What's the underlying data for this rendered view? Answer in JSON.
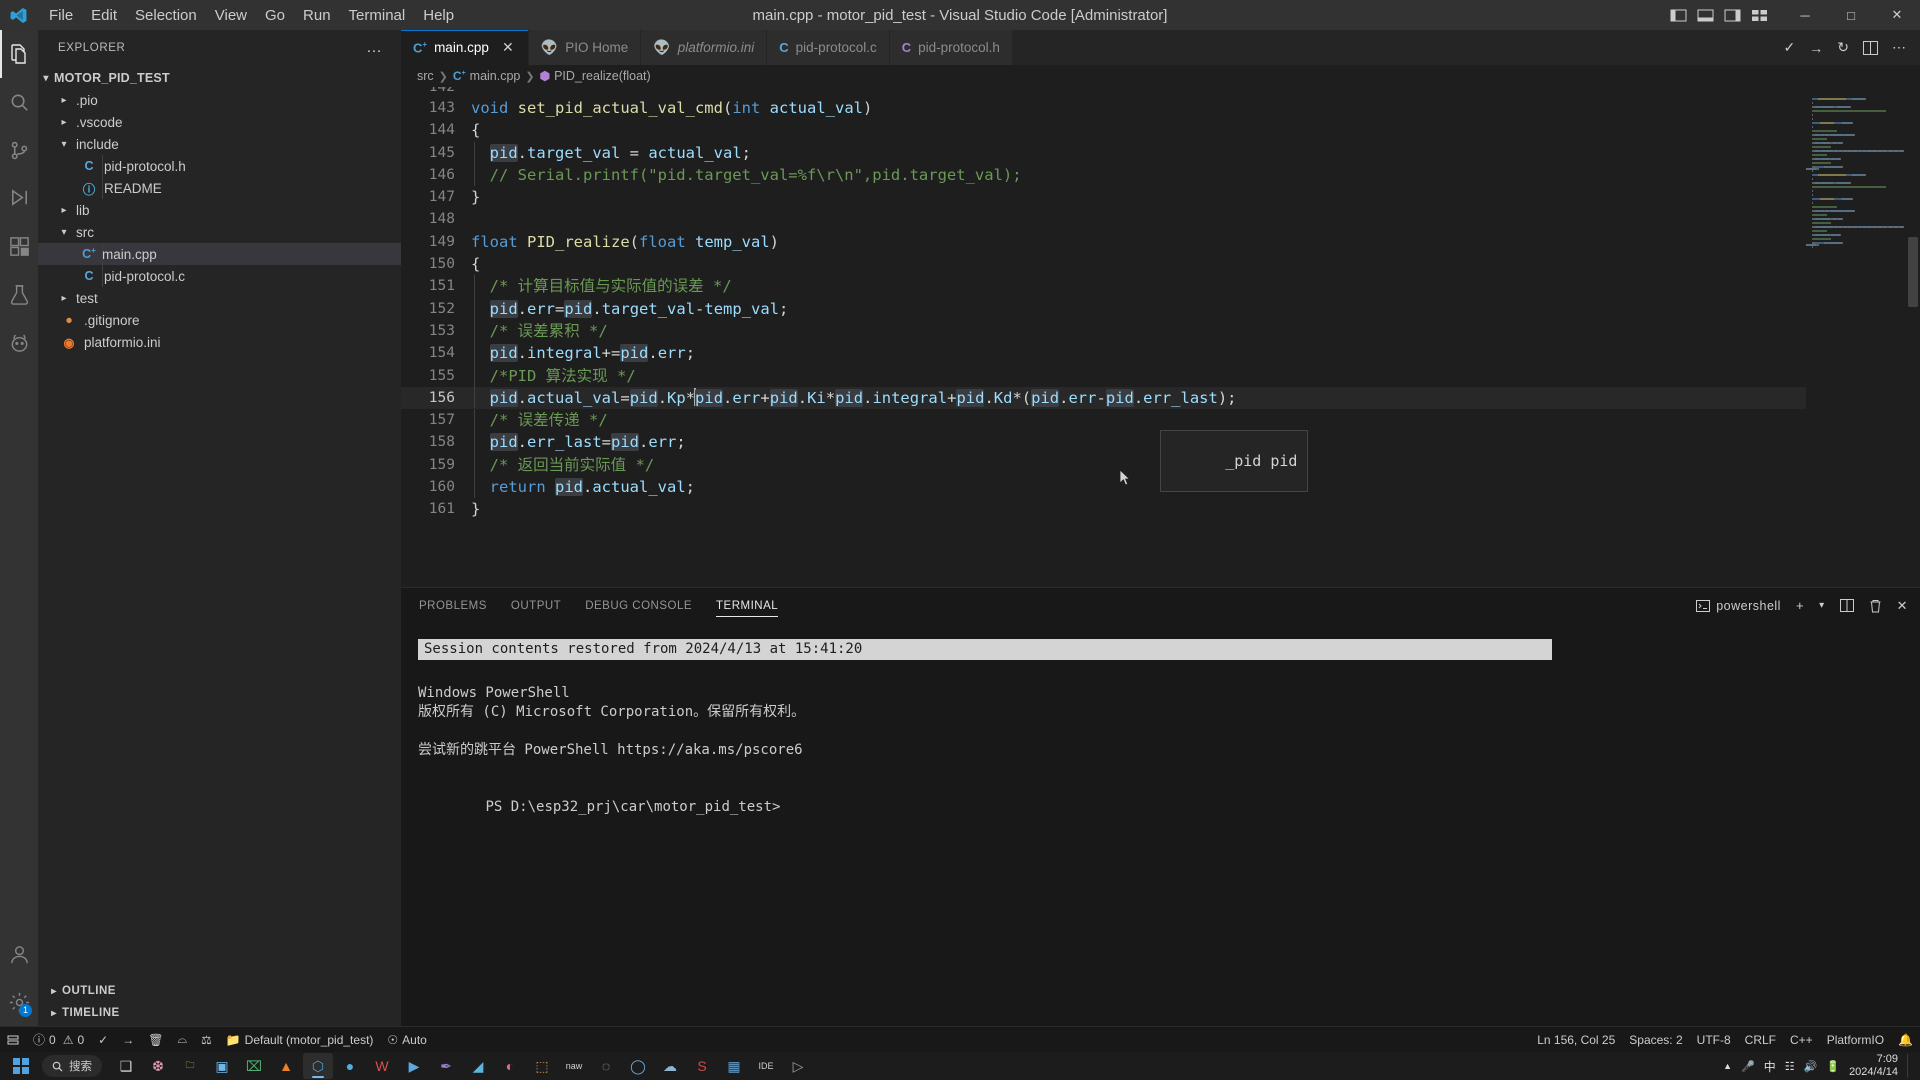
{
  "window": {
    "title": "main.cpp - motor_pid_test - Visual Studio Code [Administrator]",
    "menus": [
      "File",
      "Edit",
      "Selection",
      "View",
      "Go",
      "Run",
      "Terminal",
      "Help"
    ],
    "controls": {
      "minimize": "─",
      "maximize": "□",
      "close": "✕"
    }
  },
  "activitybar": {
    "items": [
      {
        "name": "explorer",
        "icon": "files-icon"
      },
      {
        "name": "search",
        "icon": "search-icon"
      },
      {
        "name": "source-control",
        "icon": "source-control-icon"
      },
      {
        "name": "run-debug",
        "icon": "run-debug-icon"
      },
      {
        "name": "extensions",
        "icon": "extensions-icon"
      },
      {
        "name": "testing",
        "icon": "beaker-icon"
      },
      {
        "name": "platformio",
        "icon": "alien-icon"
      }
    ],
    "bottom": [
      {
        "name": "accounts",
        "icon": "account-icon"
      },
      {
        "name": "settings",
        "icon": "gear-icon",
        "badge": "1"
      }
    ]
  },
  "sidebar": {
    "header": "EXPLORER",
    "more_label": "…",
    "root": "MOTOR_PID_TEST",
    "items": [
      {
        "label": ".pio",
        "type": "folder",
        "expanded": false,
        "depth": 1
      },
      {
        "label": ".vscode",
        "type": "folder",
        "expanded": false,
        "depth": 1
      },
      {
        "label": "include",
        "type": "folder",
        "expanded": true,
        "depth": 1
      },
      {
        "label": "pid-protocol.h",
        "type": "file-c",
        "depth": 2
      },
      {
        "label": "README",
        "type": "file-info",
        "depth": 2
      },
      {
        "label": "lib",
        "type": "folder",
        "expanded": false,
        "depth": 1
      },
      {
        "label": "src",
        "type": "folder",
        "expanded": true,
        "depth": 1
      },
      {
        "label": "main.cpp",
        "type": "file-cpp",
        "depth": 2,
        "selected": true
      },
      {
        "label": "pid-protocol.c",
        "type": "file-c",
        "depth": 2
      },
      {
        "label": "test",
        "type": "folder",
        "expanded": false,
        "depth": 1
      },
      {
        "label": ".gitignore",
        "type": "file-git",
        "depth": 1
      },
      {
        "label": "platformio.ini",
        "type": "file-ini",
        "depth": 1
      }
    ],
    "sections": [
      "OUTLINE",
      "TIMELINE"
    ]
  },
  "tabs": [
    {
      "label": "main.cpp",
      "icon": "cpp-file-icon",
      "active": true,
      "italic": false,
      "closable": true
    },
    {
      "label": "PIO Home",
      "icon": "platformio-icon",
      "active": false,
      "italic": false,
      "closable": false
    },
    {
      "label": "platformio.ini",
      "icon": "platformio-icon",
      "active": false,
      "italic": true,
      "closable": false
    },
    {
      "label": "pid-protocol.c",
      "icon": "c-file-icon",
      "active": false,
      "italic": false,
      "closable": false
    },
    {
      "label": "pid-protocol.h",
      "icon": "h-file-icon",
      "active": false,
      "italic": false,
      "closable": false
    }
  ],
  "editor_actions": [
    "check-icon",
    "split-icon",
    "refresh-icon",
    "layout-icon",
    "more-icon"
  ],
  "breadcrumb": [
    {
      "label": "src",
      "icon": ""
    },
    {
      "label": "main.cpp",
      "icon": "cpp-file-icon"
    },
    {
      "label": "PID_realize(float)",
      "icon": "function-icon"
    }
  ],
  "code": {
    "first_partial_line": "142",
    "cursor_line": 156,
    "lines": [
      {
        "n": "143",
        "tokens": [
          {
            "t": "void ",
            "c": "kw"
          },
          {
            "t": "set_pid_actual_val_cmd",
            "c": "fn"
          },
          {
            "t": "(",
            "c": "op"
          },
          {
            "t": "int",
            "c": "kw"
          },
          {
            "t": " ",
            "c": "op"
          },
          {
            "t": "actual_val",
            "c": "var"
          },
          {
            "t": ")",
            "c": "op"
          }
        ]
      },
      {
        "n": "144",
        "tokens": [
          {
            "t": "{",
            "c": "op"
          }
        ]
      },
      {
        "n": "145",
        "tokens": [
          {
            "t": "  ",
            "c": "op"
          },
          {
            "t": "pid",
            "c": "var hl"
          },
          {
            "t": ".",
            "c": "op"
          },
          {
            "t": "target_val",
            "c": "var"
          },
          {
            "t": " = ",
            "c": "op"
          },
          {
            "t": "actual_val",
            "c": "var"
          },
          {
            "t": ";",
            "c": "op"
          }
        ]
      },
      {
        "n": "146",
        "tokens": [
          {
            "t": "  // Serial.printf(\"pid.target_val=%f\\r\\n\",pid.target_val);",
            "c": "cmt"
          }
        ]
      },
      {
        "n": "147",
        "tokens": [
          {
            "t": "}",
            "c": "op"
          }
        ]
      },
      {
        "n": "148",
        "tokens": [
          {
            "t": "",
            "c": "op"
          }
        ]
      },
      {
        "n": "149",
        "tokens": [
          {
            "t": "float ",
            "c": "kw"
          },
          {
            "t": "PID_realize",
            "c": "fn"
          },
          {
            "t": "(",
            "c": "op"
          },
          {
            "t": "float",
            "c": "kw"
          },
          {
            "t": " ",
            "c": "op"
          },
          {
            "t": "temp_val",
            "c": "var"
          },
          {
            "t": ")",
            "c": "op"
          }
        ]
      },
      {
        "n": "150",
        "tokens": [
          {
            "t": "{",
            "c": "op"
          }
        ]
      },
      {
        "n": "151",
        "tokens": [
          {
            "t": "  /* 计算目标值与实际值的误差 */",
            "c": "cmt"
          }
        ]
      },
      {
        "n": "152",
        "tokens": [
          {
            "t": "  ",
            "c": "op"
          },
          {
            "t": "pid",
            "c": "var hl"
          },
          {
            "t": ".",
            "c": "op"
          },
          {
            "t": "err",
            "c": "var"
          },
          {
            "t": "=",
            "c": "op"
          },
          {
            "t": "pid",
            "c": "var hl"
          },
          {
            "t": ".",
            "c": "op"
          },
          {
            "t": "target_val",
            "c": "var"
          },
          {
            "t": "-",
            "c": "op"
          },
          {
            "t": "temp_val",
            "c": "var"
          },
          {
            "t": ";",
            "c": "op"
          }
        ]
      },
      {
        "n": "153",
        "tokens": [
          {
            "t": "  /* 误差累积 */",
            "c": "cmt"
          }
        ]
      },
      {
        "n": "154",
        "tokens": [
          {
            "t": "  ",
            "c": "op"
          },
          {
            "t": "pid",
            "c": "var hl"
          },
          {
            "t": ".",
            "c": "op"
          },
          {
            "t": "integral",
            "c": "var"
          },
          {
            "t": "+=",
            "c": "op"
          },
          {
            "t": "pid",
            "c": "var hl"
          },
          {
            "t": ".",
            "c": "op"
          },
          {
            "t": "err",
            "c": "var"
          },
          {
            "t": ";",
            "c": "op"
          }
        ]
      },
      {
        "n": "155",
        "tokens": [
          {
            "t": "  /*PID 算法实现 */",
            "c": "cmt"
          }
        ]
      },
      {
        "n": "156",
        "current": true,
        "tokens": [
          {
            "t": "  ",
            "c": "op"
          },
          {
            "t": "pid",
            "c": "var hl"
          },
          {
            "t": ".",
            "c": "op"
          },
          {
            "t": "actual_val",
            "c": "var"
          },
          {
            "t": "=",
            "c": "op"
          },
          {
            "t": "pid",
            "c": "var hl"
          },
          {
            "t": ".",
            "c": "op"
          },
          {
            "t": "Kp",
            "c": "var"
          },
          {
            "t": "*",
            "c": "op"
          },
          {
            "t": "CARET",
            "c": "caret"
          },
          {
            "t": "pid",
            "c": "var hl"
          },
          {
            "t": ".",
            "c": "op"
          },
          {
            "t": "err",
            "c": "var"
          },
          {
            "t": "+",
            "c": "op"
          },
          {
            "t": "pid",
            "c": "var hl"
          },
          {
            "t": ".",
            "c": "op"
          },
          {
            "t": "Ki",
            "c": "var"
          },
          {
            "t": "*",
            "c": "op"
          },
          {
            "t": "pid",
            "c": "var hl"
          },
          {
            "t": ".",
            "c": "op"
          },
          {
            "t": "integral",
            "c": "var"
          },
          {
            "t": "+",
            "c": "op"
          },
          {
            "t": "pid",
            "c": "var hl"
          },
          {
            "t": ".",
            "c": "op"
          },
          {
            "t": "Kd",
            "c": "var"
          },
          {
            "t": "*(",
            "c": "op"
          },
          {
            "t": "pid",
            "c": "var hl"
          },
          {
            "t": ".",
            "c": "op"
          },
          {
            "t": "err",
            "c": "var"
          },
          {
            "t": "-",
            "c": "op"
          },
          {
            "t": "pid",
            "c": "var hl"
          },
          {
            "t": ".",
            "c": "op"
          },
          {
            "t": "err_last",
            "c": "var"
          },
          {
            "t": ");",
            "c": "op"
          }
        ]
      },
      {
        "n": "157",
        "tokens": [
          {
            "t": "  /* 误差传递 */",
            "c": "cmt"
          }
        ]
      },
      {
        "n": "158",
        "tokens": [
          {
            "t": "  ",
            "c": "op"
          },
          {
            "t": "pid",
            "c": "var hl"
          },
          {
            "t": ".",
            "c": "op"
          },
          {
            "t": "err_last",
            "c": "var"
          },
          {
            "t": "=",
            "c": "op"
          },
          {
            "t": "pid",
            "c": "var hl"
          },
          {
            "t": ".",
            "c": "op"
          },
          {
            "t": "err",
            "c": "var"
          },
          {
            "t": ";",
            "c": "op"
          }
        ]
      },
      {
        "n": "159",
        "tokens": [
          {
            "t": "  /* 返回当前实际值 */",
            "c": "cmt"
          }
        ]
      },
      {
        "n": "160",
        "tokens": [
          {
            "t": "  ",
            "c": "op"
          },
          {
            "t": "return ",
            "c": "kw"
          },
          {
            "t": "pid",
            "c": "var hl"
          },
          {
            "t": ".",
            "c": "op"
          },
          {
            "t": "actual_val",
            "c": "var"
          },
          {
            "t": ";",
            "c": "op"
          }
        ]
      },
      {
        "n": "161",
        "tokens": [
          {
            "t": "}",
            "c": "op"
          }
        ]
      }
    ]
  },
  "tooltip": {
    "text": "_pid pid"
  },
  "panel": {
    "tabs": [
      {
        "label": "PROBLEMS",
        "active": false
      },
      {
        "label": "OUTPUT",
        "active": false
      },
      {
        "label": "DEBUG CONSOLE",
        "active": false
      },
      {
        "label": "TERMINAL",
        "active": true
      }
    ],
    "shell": "powershell",
    "actions": [
      "add-terminal-icon",
      "chevron-down-icon",
      "split-terminal-icon",
      "kill-terminal-icon",
      "close-panel-icon"
    ],
    "terminal": {
      "restored_notice": "Session contents restored from 2024/4/13 at 15:41:20",
      "lines": [
        "Windows PowerShell",
        "版权所有 (C) Microsoft Corporation。保留所有权利。",
        "",
        "尝试新的跳平台 PowerShell https://aka.ms/pscore6",
        "",
        "PS D:\\esp32_prj\\car\\motor_pid_test>"
      ]
    }
  },
  "statusbar": {
    "left": [
      {
        "name": "remote-indicator",
        "label": ""
      },
      {
        "name": "problems",
        "label": "0  0",
        "icon": "error-warning-icon"
      },
      {
        "name": "pio-build",
        "label": "",
        "icon": "check-icon"
      },
      {
        "name": "pio-upload",
        "label": "",
        "icon": "arrow-right-icon"
      },
      {
        "name": "pio-clean",
        "label": "",
        "icon": "trash-icon"
      },
      {
        "name": "pio-test",
        "label": "",
        "icon": "beaker-icon"
      },
      {
        "name": "pio-serial",
        "label": "",
        "icon": "plug-icon"
      },
      {
        "name": "pio-env",
        "label": "Default (motor_pid_test)",
        "icon": "folder-icon"
      },
      {
        "name": "pio-auto",
        "label": "Auto",
        "icon": "target-icon"
      }
    ],
    "right": [
      {
        "name": "cursor-position",
        "label": "Ln 156, Col 25"
      },
      {
        "name": "indentation",
        "label": "Spaces: 2"
      },
      {
        "name": "encoding",
        "label": "UTF-8"
      },
      {
        "name": "eol",
        "label": "CRLF"
      },
      {
        "name": "language-mode",
        "label": "C++"
      },
      {
        "name": "platformio",
        "label": "PlatformIO"
      },
      {
        "name": "notifications",
        "label": "",
        "icon": "bell-icon"
      }
    ]
  },
  "taskbar": {
    "search_placeholder": "搜索",
    "clock": {
      "time": "7:09",
      "date": "2024/4/14"
    },
    "ime": "中",
    "apps": [
      {
        "name": "taskview",
        "glyph": "❑",
        "color": "#cfcfcf"
      },
      {
        "name": "widgets",
        "glyph": "❆",
        "color": "#f0a3c0"
      },
      {
        "name": "explorer",
        "glyph": "🗀",
        "color": "#e8c35b"
      },
      {
        "name": "store",
        "glyph": "▣",
        "color": "#6fb7e8"
      },
      {
        "name": "excel",
        "glyph": "⌧",
        "color": "#4fae6e"
      },
      {
        "name": "vlc",
        "glyph": "▲",
        "color": "#e8822b"
      },
      {
        "name": "vscode",
        "glyph": "⬡",
        "color": "#4f9fd4",
        "active": true
      },
      {
        "name": "edge",
        "glyph": "●",
        "color": "#4cb0e0"
      },
      {
        "name": "wps",
        "glyph": "W",
        "color": "#d9504a"
      },
      {
        "name": "player",
        "glyph": "▶",
        "color": "#5ca8e0"
      },
      {
        "name": "paint",
        "glyph": "✒",
        "color": "#9a7fd4"
      },
      {
        "name": "drawing",
        "glyph": "◢",
        "color": "#5bb3e0"
      },
      {
        "name": "palette",
        "glyph": "◐",
        "color": "#e06c8a"
      },
      {
        "name": "charts",
        "glyph": "⬚",
        "color": "#c3974f"
      },
      {
        "name": "naw",
        "glyph": "naw",
        "color": "#d4d4d4"
      },
      {
        "name": "chat",
        "glyph": "◌",
        "color": "#b0b0b0"
      },
      {
        "name": "disc",
        "glyph": "◯",
        "color": "#6ea8d8"
      },
      {
        "name": "cloud",
        "glyph": "☁",
        "color": "#8fb4cf"
      },
      {
        "name": "sw2018",
        "glyph": "S",
        "color": "#d04a4a"
      },
      {
        "name": "pictures",
        "glyph": "▦",
        "color": "#5f9ecf"
      },
      {
        "name": "ide",
        "glyph": "IDE",
        "color": "#cfcfcf"
      },
      {
        "name": "terminal-app",
        "glyph": "▷",
        "color": "#a0a0a0"
      }
    ],
    "tray": [
      "chevron-up-icon",
      "mic-icon",
      "network-icon",
      "volume-icon",
      "battery-icon"
    ]
  },
  "colors": {
    "accent": "#0078d4",
    "editor_bg": "#1e1e1e",
    "sidebar_bg": "#252526",
    "titlebar_bg": "#323233",
    "statusbar_bg": "#181818",
    "keyword": "#569cd6",
    "comment": "#6a9955",
    "variable": "#9cdcfe",
    "function": "#dcdcaa"
  }
}
